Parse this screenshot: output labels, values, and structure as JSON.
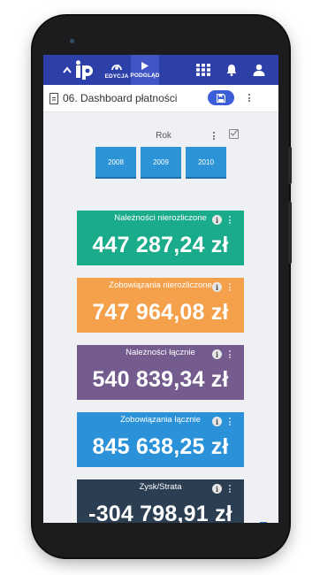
{
  "app": {
    "mode_tabs": [
      {
        "label": "EDYCJA",
        "icon": "edit-mode-icon"
      },
      {
        "label": "PODGLĄD",
        "icon": "play-icon",
        "active": true
      }
    ],
    "brand_colors": {
      "topbar": "#2d3fa8",
      "save": "#3b5ed8",
      "year_button": "#2c93d6"
    }
  },
  "page": {
    "title": "06. Dashboard płatności"
  },
  "year_filter": {
    "label": "Rok",
    "years": [
      "2008",
      "2009",
      "2010"
    ]
  },
  "cards": [
    {
      "label": "Należności nierozliczone",
      "value": "447 287,24 zł",
      "color": "#1aab8b"
    },
    {
      "label": "Zobowiązania nierozliczone",
      "value": "747 964,08 zł",
      "color": "#f5a04a"
    },
    {
      "label": "Należności łącznie",
      "value": "540 839,34 zł",
      "color": "#745c8f"
    },
    {
      "label": "Zobowiązania łącznie",
      "value": "845 638,25 zł",
      "color": "#2b92d9"
    },
    {
      "label": "Zysk/Strata",
      "value": "-304 798,91 zł",
      "color": "#2b3e52"
    }
  ]
}
